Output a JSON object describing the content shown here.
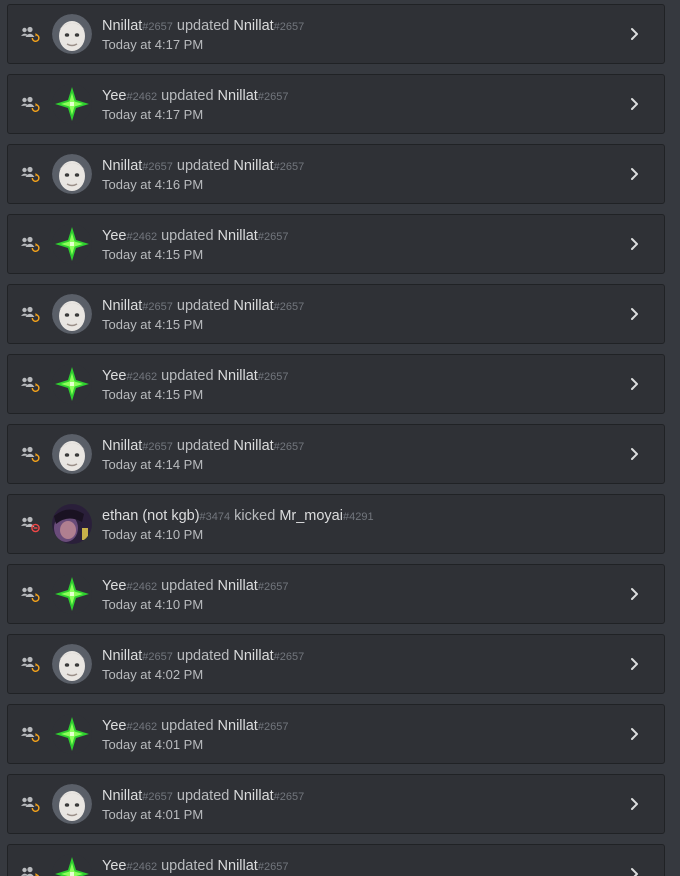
{
  "audit_log": {
    "entries": [
      {
        "actor": "Nnillat",
        "actor_tag": "#2657",
        "action": "updated",
        "target": "Nnillat",
        "target_tag": "#2657",
        "time": "Today at 4:17 PM",
        "avatar": "pale-face",
        "type": "member-update",
        "expandable": true
      },
      {
        "actor": "Yee",
        "actor_tag": "#2462",
        "action": "updated",
        "target": "Nnillat",
        "target_tag": "#2657",
        "time": "Today at 4:17 PM",
        "avatar": "green-star",
        "type": "member-update",
        "expandable": true
      },
      {
        "actor": "Nnillat",
        "actor_tag": "#2657",
        "action": "updated",
        "target": "Nnillat",
        "target_tag": "#2657",
        "time": "Today at 4:16 PM",
        "avatar": "pale-face",
        "type": "member-update",
        "expandable": true
      },
      {
        "actor": "Yee",
        "actor_tag": "#2462",
        "action": "updated",
        "target": "Nnillat",
        "target_tag": "#2657",
        "time": "Today at 4:15 PM",
        "avatar": "green-star",
        "type": "member-update",
        "expandable": true
      },
      {
        "actor": "Nnillat",
        "actor_tag": "#2657",
        "action": "updated",
        "target": "Nnillat",
        "target_tag": "#2657",
        "time": "Today at 4:15 PM",
        "avatar": "pale-face",
        "type": "member-update",
        "expandable": true
      },
      {
        "actor": "Yee",
        "actor_tag": "#2462",
        "action": "updated",
        "target": "Nnillat",
        "target_tag": "#2657",
        "time": "Today at 4:15 PM",
        "avatar": "green-star",
        "type": "member-update",
        "expandable": true
      },
      {
        "actor": "Nnillat",
        "actor_tag": "#2657",
        "action": "updated",
        "target": "Nnillat",
        "target_tag": "#2657",
        "time": "Today at 4:14 PM",
        "avatar": "pale-face",
        "type": "member-update",
        "expandable": true
      },
      {
        "actor": "ethan (not kgb)",
        "actor_tag": "#3474",
        "action": "kicked",
        "target": "Mr_moyai",
        "target_tag": "#4291",
        "time": "Today at 4:10 PM",
        "avatar": "dark-photo",
        "type": "member-kick",
        "expandable": false
      },
      {
        "actor": "Yee",
        "actor_tag": "#2462",
        "action": "updated",
        "target": "Nnillat",
        "target_tag": "#2657",
        "time": "Today at 4:10 PM",
        "avatar": "green-star",
        "type": "member-update",
        "expandable": true
      },
      {
        "actor": "Nnillat",
        "actor_tag": "#2657",
        "action": "updated",
        "target": "Nnillat",
        "target_tag": "#2657",
        "time": "Today at 4:02 PM",
        "avatar": "pale-face",
        "type": "member-update",
        "expandable": true
      },
      {
        "actor": "Yee",
        "actor_tag": "#2462",
        "action": "updated",
        "target": "Nnillat",
        "target_tag": "#2657",
        "time": "Today at 4:01 PM",
        "avatar": "green-star",
        "type": "member-update",
        "expandable": true
      },
      {
        "actor": "Nnillat",
        "actor_tag": "#2657",
        "action": "updated",
        "target": "Nnillat",
        "target_tag": "#2657",
        "time": "Today at 4:01 PM",
        "avatar": "pale-face",
        "type": "member-update",
        "expandable": true
      },
      {
        "actor": "Yee",
        "actor_tag": "#2462",
        "action": "updated",
        "target": "Nnillat",
        "target_tag": "#2657",
        "time": "",
        "avatar": "green-star",
        "type": "member-update",
        "expandable": true
      }
    ]
  },
  "colors": {
    "page_background": "#36393f",
    "entry_background": "#2f3136",
    "entry_border": "#202225",
    "name_text": "#dcddde",
    "secondary_text": "#b9bbbe",
    "discriminator_text": "#72767d",
    "update_badge": "#faa61a",
    "kick_badge": "#f04747"
  },
  "icons": {
    "member_update": "members-update-icon",
    "member_kick": "members-kick-icon",
    "expand": "chevron-right-icon"
  }
}
